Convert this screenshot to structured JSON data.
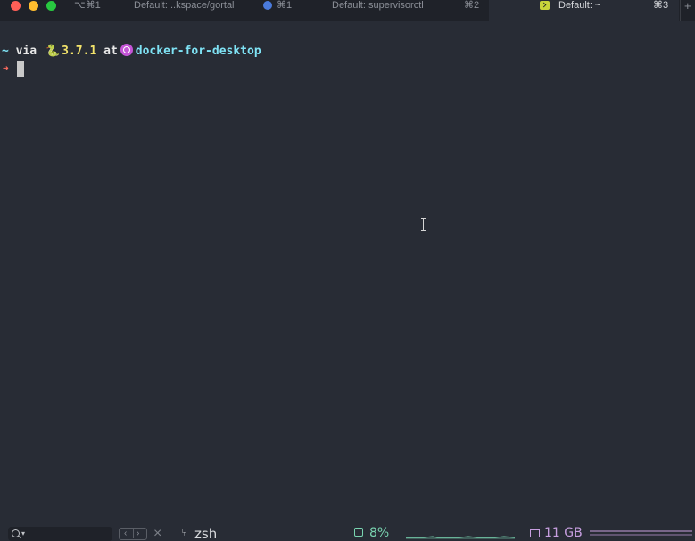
{
  "tabs": [
    {
      "shortcut": "⌥⌘1",
      "title": "Default: ..kspace/gortal"
    },
    {
      "shortcut": "⌘1",
      "title": "Default: supervisorctl",
      "shortcut2": "⌘2"
    },
    {
      "title": "Default: ~",
      "shortcut": "⌘3",
      "active": true
    }
  ],
  "new_tab_label": "+",
  "prompt": {
    "dir": "~",
    "via": "via",
    "python_icon": "🐍",
    "python_version": "3.7.1",
    "at": "at",
    "k8s_icon": "kubernetes-wheel",
    "k8s_context": "docker-for-desktop",
    "arrow": "➜"
  },
  "statusbar": {
    "search_caret": "▾",
    "nav_prev": "‹",
    "nav_next": "›",
    "close": "×",
    "branch_icon": "⑂",
    "process": "zsh",
    "cpu_percent": "8%",
    "memory": "11 GB"
  },
  "colors": {
    "background": "#282c35",
    "tabbar": "#1f2229",
    "accent_cyan": "#7fe3f5",
    "accent_yellow": "#f4e46b",
    "cpu_green": "#79d4b0",
    "mem_purple": "#c79fe0",
    "arrow_red": "#ff6b5f"
  }
}
